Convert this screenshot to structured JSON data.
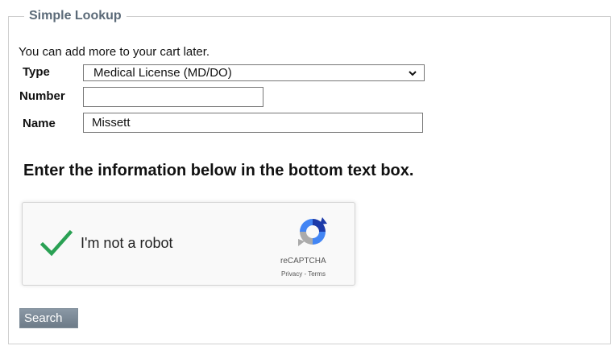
{
  "fieldset": {
    "legend": "Simple Lookup"
  },
  "intro_text": "You can add more to your cart later.",
  "form": {
    "type": {
      "label": "Type",
      "selected": "Medical License (MD/DO)"
    },
    "number": {
      "label": "Number",
      "value": ""
    },
    "name": {
      "label": "Name",
      "value": "Missett"
    }
  },
  "instruction": "Enter the information below in the bottom text box.",
  "captcha": {
    "label": "I'm not a robot",
    "brand": "reCAPTCHA",
    "links": "Privacy - Terms",
    "checked": true,
    "check_color": "#2aa154"
  },
  "search_button": "Search",
  "colors": {
    "legend": "#5b6a78",
    "button_bg": "#7b8996",
    "border": "#cfcfcf"
  }
}
